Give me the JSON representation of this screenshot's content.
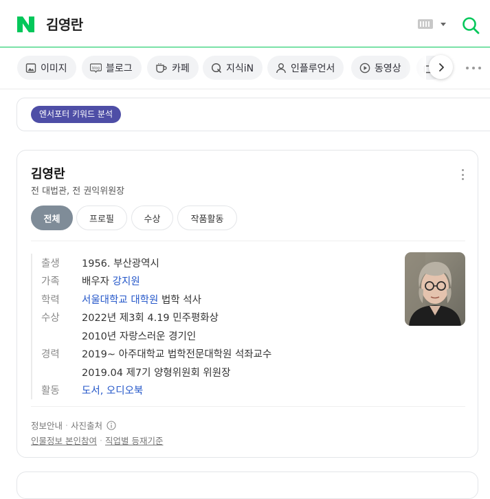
{
  "header": {
    "query": "김영란",
    "logo_icon": "naver-n-logo-icon",
    "brand_color": "#03c75a"
  },
  "tabs": [
    {
      "label": "이미지",
      "icon": "image-icon"
    },
    {
      "label": "블로그",
      "icon": "blog-icon"
    },
    {
      "label": "카페",
      "icon": "cafe-cup-icon"
    },
    {
      "label": "지식iN",
      "icon": "kin-icon"
    },
    {
      "label": "인플루언서",
      "icon": "person-icon"
    },
    {
      "label": "동영상",
      "icon": "play-icon"
    }
  ],
  "keyword_panel": {
    "badge": "엔서포터 키워드 분석",
    "badge_color": "#4e4ea6"
  },
  "profile": {
    "name": "김영란",
    "subtitle": "전 대법관, 전 권익위원장",
    "tabs": [
      "전체",
      "프로필",
      "수상",
      "작품활동"
    ],
    "active_tab": "전체",
    "info": {
      "birth_label": "출생",
      "birth_value": "1956. 부산광역시",
      "family_label": "가족",
      "family_prefix": "배우자 ",
      "family_link": "강지원",
      "edu_label": "학력",
      "edu_link1": "서울대학교",
      "edu_link2": "대학원",
      "edu_suffix": " 법학 석사",
      "award_label": "수상",
      "award_1": "2022년 제3회 4.19 민주평화상",
      "award_2": "2010년 자랑스러운 경기인",
      "career_label": "경력",
      "career_1": "2019~ 아주대학교 법학전문대학원 석좌교수",
      "career_2": "2019.04 제7기 양형위원회 위원장",
      "activity_label": "활동",
      "activity_link1": "도서",
      "activity_link2": "오디오북"
    },
    "footer": {
      "info_guide": "정보안내",
      "photo_source": "사진출처",
      "participation": "인물정보 본인참여",
      "criteria": "직업별 등재기준"
    }
  }
}
